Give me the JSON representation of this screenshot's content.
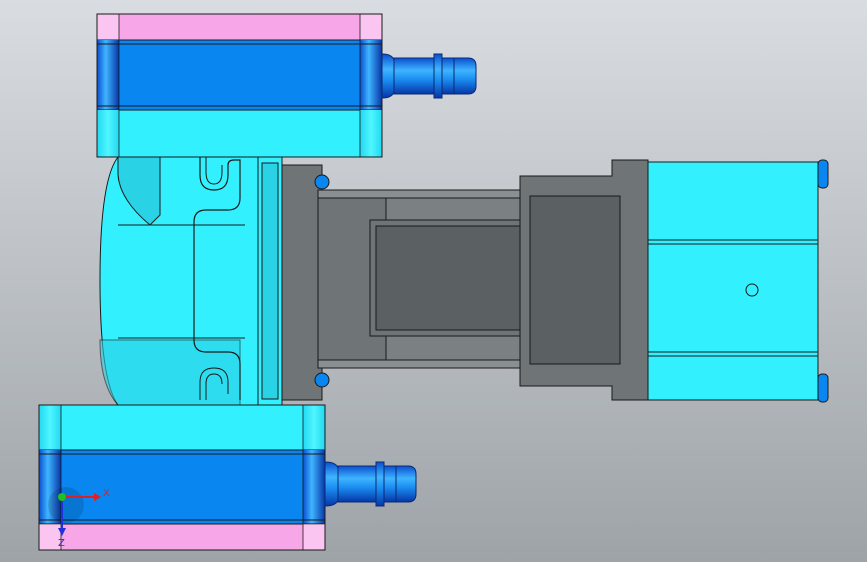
{
  "viewport": {
    "background_top": "#d9dde2",
    "background_bottom": "#9ea3a8"
  },
  "colors": {
    "cyan": "#33f0ff",
    "blue": "#0a86f0",
    "pink": "#f7a6e8",
    "gray": "#6f7476",
    "gray_dark": "#5b6062",
    "edge": "#1a1a1a"
  },
  "triad": {
    "x_label": "X",
    "z_label": "Z",
    "x_color": "#e02020",
    "y_color": "#20c020",
    "z_color": "#2030e0"
  }
}
